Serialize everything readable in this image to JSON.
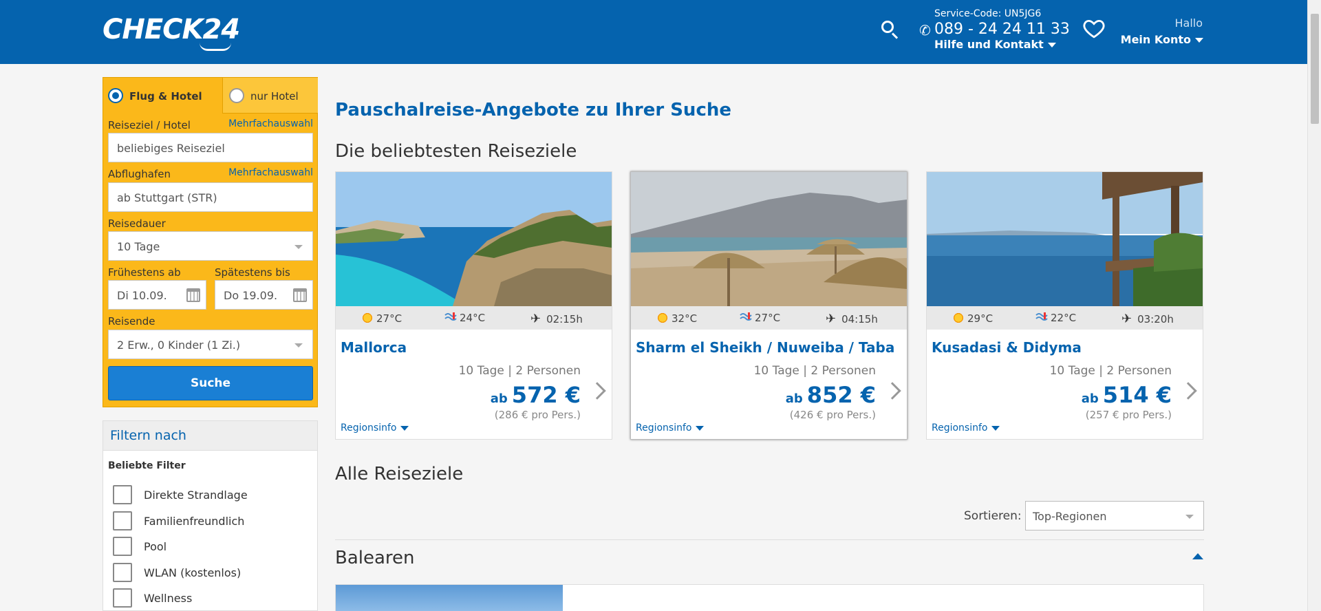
{
  "header": {
    "logo": "CHECK24",
    "service_code": "Service-Code: UN5JG6",
    "phone": "089 - 24 24 11 33",
    "help": "Hilfe und Kontakt",
    "greeting": "Hallo",
    "account": "Mein Konto",
    "colors": {
      "brand": "#0563ae"
    }
  },
  "search": {
    "tab_flight_hotel": "Flug & Hotel",
    "tab_hotel_only": "nur Hotel",
    "destination_label": "Reiseziel / Hotel",
    "destination_multi": "Mehrfachauswahl",
    "destination_value": "beliebiges Reiseziel",
    "airport_label": "Abflughafen",
    "airport_multi": "Mehrfachauswahl",
    "airport_value": "ab Stuttgart (STR)",
    "duration_label": "Reisedauer",
    "duration_value": "10 Tage",
    "earliest_label": "Frühestens ab",
    "earliest_value": "Di 10.09.",
    "latest_label": "Spätestens bis",
    "latest_value": "Do 19.09.",
    "travellers_label": "Reisende",
    "travellers_value": "2 Erw., 0 Kinder (1 Zi.)",
    "submit": "Suche",
    "colors": {
      "panel": "#fbb81a",
      "button": "#1a7fd4"
    }
  },
  "filters": {
    "title": "Filtern nach",
    "subtitle": "Beliebte Filter",
    "items": [
      {
        "label": "Direkte Strandlage"
      },
      {
        "label": "Familienfreundlich"
      },
      {
        "label": "Pool"
      },
      {
        "label": "WLAN (kostenlos)"
      },
      {
        "label": "Wellness"
      }
    ]
  },
  "main": {
    "title": "Pauschalreise-Angebote zu Ihrer Suche",
    "popular_title": "Die beliebtesten Reiseziele",
    "all_title": "Alle Reiseziele",
    "sort_label": "Sortieren:",
    "sort_value": "Top-Regionen",
    "region_section": "Balearen"
  },
  "destinations": [
    {
      "name": "Mallorca",
      "air_temp": "27°C",
      "water_temp": "24°C",
      "flight_time": "02:15h",
      "duration": "10 Tage | 2 Personen",
      "price_prefix": "ab",
      "price": "572 €",
      "per_person": "(286 € pro Pers.)",
      "region_info": "Regionsinfo"
    },
    {
      "name": "Sharm el Sheikh / Nuweiba / Taba",
      "air_temp": "32°C",
      "water_temp": "27°C",
      "flight_time": "04:15h",
      "duration": "10 Tage | 2 Personen",
      "price_prefix": "ab",
      "price": "852 €",
      "per_person": "(426 € pro Pers.)",
      "region_info": "Regionsinfo"
    },
    {
      "name": "Kusadasi & Didyma",
      "air_temp": "29°C",
      "water_temp": "22°C",
      "flight_time": "03:20h",
      "duration": "10 Tage | 2 Personen",
      "price_prefix": "ab",
      "price": "514 €",
      "per_person": "(257 € pro Pers.)",
      "region_info": "Regionsinfo"
    }
  ]
}
